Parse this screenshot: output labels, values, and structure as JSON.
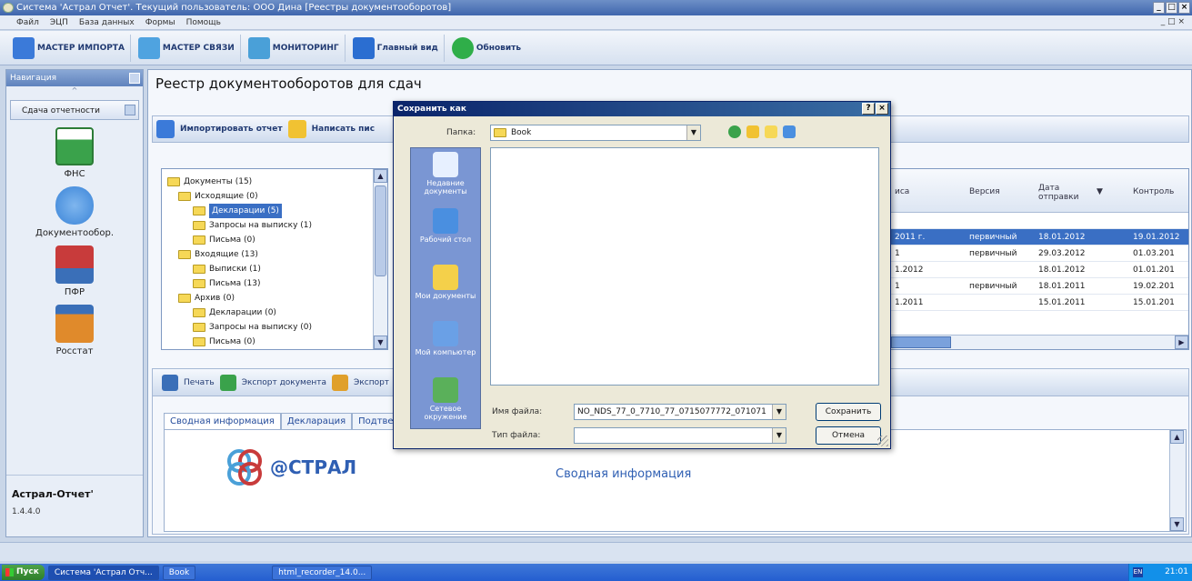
{
  "window": {
    "title": "Система 'Астрал Отчет'. Текущий пользователь: ООО Дина   [Реестры документооборотов]",
    "min": "_",
    "max": "□",
    "close": "×",
    "mdi_controls": "_ □ ×"
  },
  "menu": [
    "Файл",
    "ЭЦП",
    "База данных",
    "Формы",
    "Помощь"
  ],
  "toolbar": [
    {
      "label": "МАСТЕР ИМПОРТА",
      "color": "#3b7ad9"
    },
    {
      "label": "МАСТЕР СВЯЗИ",
      "color": "#4fa3e0"
    },
    {
      "label": "МОНИТОРИНГ",
      "color": "#4aa0d8"
    },
    {
      "label": "Главный вид",
      "color": "#2b6ed1"
    },
    {
      "label": "Обновить",
      "color": "#2fae49"
    }
  ],
  "sidebar": {
    "header": "Навигация",
    "section": "Сдача отчетности",
    "items": [
      {
        "label": "ФНС",
        "color": "#3aa24b"
      },
      {
        "label": "Документообор.",
        "color": "#3a84d8"
      },
      {
        "label": "ПФР",
        "color": "#c83b3b"
      },
      {
        "label": "Росстат",
        "color": "#e08a2b"
      }
    ],
    "app_name": "Астрал-Отчет'",
    "version": "1.4.4.0"
  },
  "main": {
    "title": "Реестр документооборотов для сдач",
    "import_btn": "Импортировать отчет",
    "write_btn": "Написать пис"
  },
  "tree": [
    {
      "label": "Документы (15)",
      "level": 0
    },
    {
      "label": "Исходящие (0)",
      "level": 1
    },
    {
      "label": "Декларации (5)",
      "level": 2,
      "selected": true
    },
    {
      "label": "Запросы на выписку (1)",
      "level": 2
    },
    {
      "label": "Письма (0)",
      "level": 2
    },
    {
      "label": "Входящие (13)",
      "level": 1
    },
    {
      "label": "Выписки (1)",
      "level": 2
    },
    {
      "label": "Письма (13)",
      "level": 2
    },
    {
      "label": "Архив (0)",
      "level": 1
    },
    {
      "label": "Декларации (0)",
      "level": 2
    },
    {
      "label": "Запросы на выписку (0)",
      "level": 2
    },
    {
      "label": "Письма (0)",
      "level": 2
    }
  ],
  "grid": {
    "columns": [
      "иса",
      "Версия",
      "Дата отправки",
      "Контроль"
    ],
    "rows": [
      {
        "c0": "2011 г.",
        "c1": "первичный",
        "c2": "18.01.2012",
        "c3": "19.01.2012",
        "selected": true
      },
      {
        "c0": "1",
        "c1": "первичный",
        "c2": "29.03.2012",
        "c3": "01.03.201",
        "selected": false
      },
      {
        "c0": "1.2012",
        "c1": "",
        "c2": "18.01.2012",
        "c3": "01.01.201",
        "selected": false
      },
      {
        "c0": "1",
        "c1": "первичный",
        "c2": "18.01.2011",
        "c3": "19.02.201",
        "selected": false
      },
      {
        "c0": "1.2011",
        "c1": "",
        "c2": "15.01.2011",
        "c3": "15.01.201",
        "selected": false
      }
    ]
  },
  "lower": {
    "print_btn": "Печать",
    "export_doc_btn": "Экспорт документа",
    "export_btn": "Экспорт",
    "tabs": [
      "Сводная информация",
      "Декларация",
      "Подтве"
    ],
    "info_link": "Сводная информация",
    "logo_text": "@СТРАЛ"
  },
  "dialog": {
    "title": "Сохранить как",
    "help": "?",
    "close": "×",
    "folder_label": "Папка:",
    "folder_value": "Book",
    "places": [
      {
        "label": "Недавние документы",
        "color": "#e7f0ff"
      },
      {
        "label": "Рабочий стол",
        "color": "#4a8fe0"
      },
      {
        "label": "Мои документы",
        "color": "#f4d04a"
      },
      {
        "label": "Мой компьютер",
        "color": "#6aa0e6"
      },
      {
        "label": "Сетевое окружение",
        "color": "#5ab05a"
      }
    ],
    "filename_label": "Имя файла:",
    "filename_value": "NO_NDS_77_0_7710_77_0715077772_071071",
    "filetype_label": "Тип файла:",
    "filetype_value": "",
    "save_btn": "Сохранить",
    "cancel_btn": "Отмена"
  },
  "taskbar": {
    "start": "Пуск",
    "tasks": [
      "Система 'Астрал Отч...",
      "Book",
      "html_recorder_14.0..."
    ],
    "lang": "EN",
    "clock": "21:01"
  }
}
